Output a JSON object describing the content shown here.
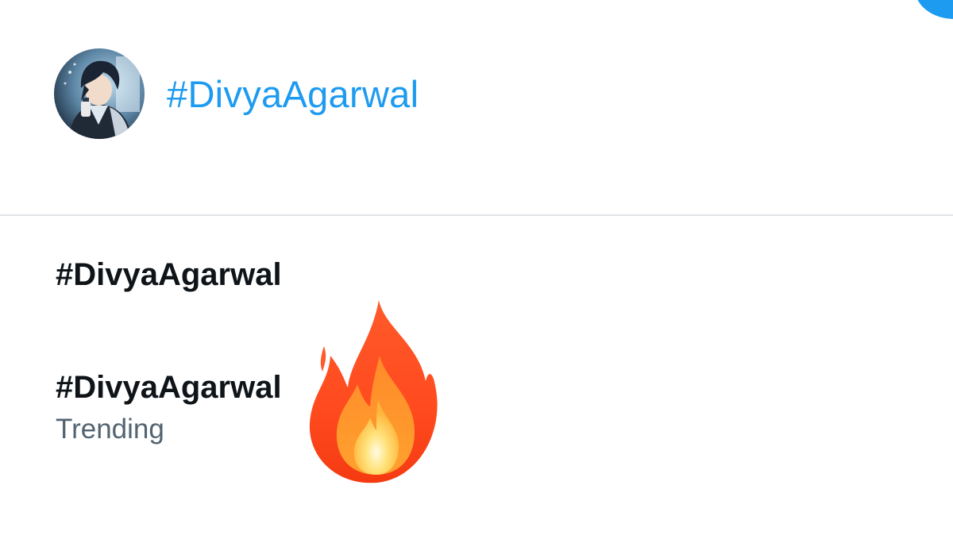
{
  "compose": {
    "avatar_icon": "anime-avatar-icon",
    "text": "#DivyaAgarwal",
    "text_color": "#1d9bf0"
  },
  "suggestions": [
    {
      "title": "#DivyaAgarwal"
    },
    {
      "title": "#DivyaAgarwal",
      "subtitle": "Trending"
    }
  ],
  "overlay": {
    "icon": "fire-emoji-icon"
  },
  "colors": {
    "accent": "#1d9bf0",
    "primary_text": "#0f1419",
    "secondary_text": "#536471",
    "divider": "#dfe3e6"
  }
}
